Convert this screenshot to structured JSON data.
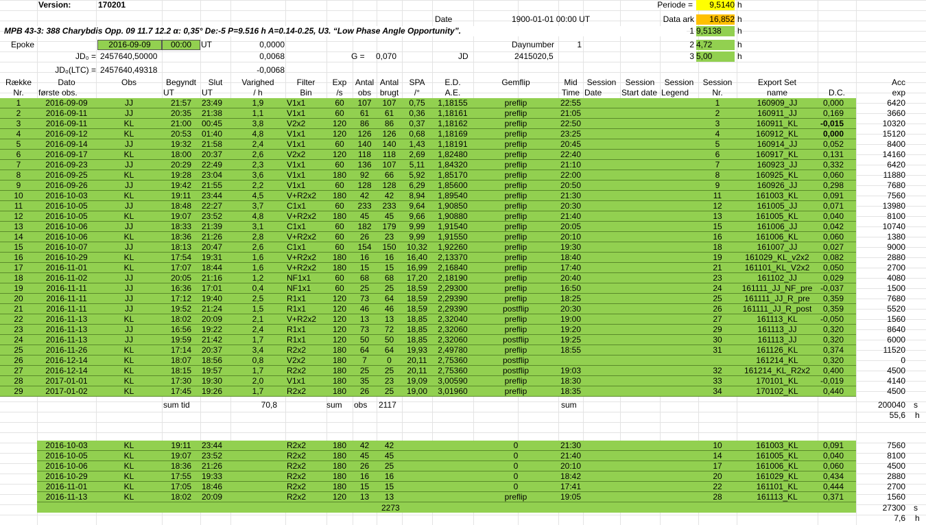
{
  "top": {
    "version_label": "Version:",
    "version_value": "170201",
    "periode_label": "Periode =",
    "periode_value": "9,5140",
    "periode_unit": "h",
    "date_label": "Date",
    "date_value": "1900-01-01  00:00  UT",
    "data_ark_label": "Data ark",
    "data_ark_value": "16,852",
    "data_ark_unit": "h",
    "title": "MPB 43-3: 388 Charybdis Opp. 09 11.7 12.2 α: 0,35° De:-5 P=9.516 h A=0.14-0.25, U3. “Low Phase Angle Opportunity”.",
    "p1_index": "1",
    "p1_value": "9,5138",
    "p1_unit": "h",
    "epoke_label": "Epoke",
    "epoke_date": "2016-09-09",
    "epoke_time": "00:00",
    "epoke_ut": "UT",
    "epoke_num": "0,0000",
    "daynumber_label": "Daynumber",
    "daynumber_value": "1",
    "p2_index": "2",
    "p2_value": "4,72",
    "p2_unit": "h",
    "jd0_label": "JD₀ =",
    "jd0_value": "2457640,50000",
    "jd0_num": "0,0068",
    "g_label": "G =",
    "g_value": "0,070",
    "jd_label": "JD",
    "jd_value": "2415020,5",
    "p3_index": "3",
    "p3_value": "5,00",
    "p3_unit": "h",
    "jd0ltc_label": "JD₀(LTC) =",
    "jd0ltc_value": "2457640,49318",
    "jd0ltc_num": "-0,0068",
    "colors": {
      "green": "#92d050",
      "yellow": "#ffff00",
      "orange": "#ffc000"
    }
  },
  "headers": {
    "row1": [
      "Række",
      "Dato",
      "Obs",
      "Begyndt",
      "Slut",
      "Varighed",
      "Filter",
      "Exp",
      "Antal",
      "Antal",
      "SPA",
      "E.D.",
      "Gemflip",
      "Mid",
      "Session",
      "Session",
      "Session",
      "Session",
      "Export Set",
      "",
      "Acc"
    ],
    "row2": [
      "Nr.",
      "første obs.",
      "",
      "UT",
      "UT",
      "/ h",
      "Bin",
      "/s",
      "obs",
      "brugt",
      "/°",
      "A.E.",
      "",
      "Time",
      "Date",
      "Start date",
      "Legend",
      "Nr.",
      "name",
      "D.C.",
      "exp"
    ]
  },
  "rows": [
    [
      "1",
      "2016-09-09",
      "JJ",
      "21:57",
      "23:49",
      "1,9",
      "V1x1",
      "60",
      "107",
      "107",
      "0,75",
      "1,18155",
      "preflip",
      "22:55",
      "1",
      "160909_JJ",
      "0,000",
      "6420"
    ],
    [
      "2",
      "2016-09-11",
      "JJ",
      "20:35",
      "21:38",
      "1,1",
      "V1x1",
      "60",
      "61",
      "61",
      "0,36",
      "1,18161",
      "preflip",
      "21:05",
      "2",
      "160911_JJ",
      "0,169",
      "3660"
    ],
    [
      "3",
      "2016-09-11",
      "KL",
      "21:00",
      "00:45",
      "3,8",
      "V2x2",
      "120",
      "86",
      "86",
      "0,37",
      "1,18162",
      "preflip",
      "22:50",
      "3",
      "160911_KL",
      "-0,015",
      "10320"
    ],
    [
      "4",
      "2016-09-12",
      "KL",
      "20:53",
      "01:40",
      "4,8",
      "V1x1",
      "120",
      "126",
      "126",
      "0,68",
      "1,18169",
      "preflip",
      "23:25",
      "4",
      "160912_KL",
      "0,000",
      "15120"
    ],
    [
      "5",
      "2016-09-14",
      "JJ",
      "19:32",
      "21:58",
      "2,4",
      "V1x1",
      "60",
      "140",
      "140",
      "1,43",
      "1,18191",
      "preflip",
      "20:45",
      "5",
      "160914_JJ",
      "0,052",
      "8400"
    ],
    [
      "6",
      "2016-09-17",
      "KL",
      "18:00",
      "20:37",
      "2,6",
      "V2x2",
      "120",
      "118",
      "118",
      "2,69",
      "1,82480",
      "preflip",
      "22:40",
      "6",
      "160917_KL",
      "0,131",
      "14160"
    ],
    [
      "7",
      "2016-09-23",
      "JJ",
      "20:29",
      "22:49",
      "2,3",
      "V1x1",
      "60",
      "136",
      "107",
      "5,11",
      "1,84320",
      "preflip",
      "21:10",
      "7",
      "160923_JJ",
      "0,332",
      "6420"
    ],
    [
      "8",
      "2016-09-25",
      "KL",
      "19:28",
      "23:04",
      "3,6",
      "V1x1",
      "180",
      "92",
      "66",
      "5,92",
      "1,85170",
      "preflip",
      "22:00",
      "8",
      "160925_KL",
      "0,060",
      "11880"
    ],
    [
      "9",
      "2016-09-26",
      "JJ",
      "19:42",
      "21:55",
      "2,2",
      "V1x1",
      "60",
      "128",
      "128",
      "6,29",
      "1,85600",
      "preflip",
      "20:50",
      "9",
      "160926_JJ",
      "0,298",
      "7680"
    ],
    [
      "10",
      "2016-10-03",
      "KL",
      "19:11",
      "23:44",
      "4,5",
      "V+R2x2",
      "180",
      "42",
      "42",
      "8,94",
      "1,89540",
      "preflip",
      "21:30",
      "11",
      "161003_KL",
      "0,091",
      "7560"
    ],
    [
      "11",
      "2016-10-05",
      "JJ",
      "18:48",
      "22:27",
      "3,7",
      "C1x1",
      "60",
      "233",
      "233",
      "9,64",
      "1,90850",
      "preflip",
      "20:30",
      "12",
      "161005_JJ",
      "0,071",
      "13980"
    ],
    [
      "12",
      "2016-10-05",
      "KL",
      "19:07",
      "23:52",
      "4,8",
      "V+R2x2",
      "180",
      "45",
      "45",
      "9,66",
      "1,90880",
      "preflip",
      "21:40",
      "13",
      "161005_KL",
      "0,040",
      "8100"
    ],
    [
      "13",
      "2016-10-06",
      "JJ",
      "18:33",
      "21:39",
      "3,1",
      "C1x1",
      "60",
      "182",
      "179",
      "9,99",
      "1,91540",
      "preflip",
      "20:05",
      "15",
      "161006_JJ",
      "0,042",
      "10740"
    ],
    [
      "14",
      "2016-10-06",
      "KL",
      "18:36",
      "21:26",
      "2,8",
      "V+R2x2",
      "60",
      "26",
      "23",
      "9,99",
      "1,91550",
      "preflip",
      "20:10",
      "16",
      "161006_KL",
      "0,060",
      "1380"
    ],
    [
      "15",
      "2016-10-07",
      "JJ",
      "18:13",
      "20:47",
      "2,6",
      "C1x1",
      "60",
      "154",
      "150",
      "10,32",
      "1,92260",
      "preflip",
      "19:30",
      "18",
      "161007_JJ",
      "0,027",
      "9000"
    ],
    [
      "16",
      "2016-10-29",
      "KL",
      "17:54",
      "19:31",
      "1,6",
      "V+R2x2",
      "180",
      "16",
      "16",
      "16,40",
      "2,13370",
      "preflip",
      "18:40",
      "19",
      "161029_KL_v2x2",
      "0,082",
      "2880"
    ],
    [
      "17",
      "2016-11-01",
      "KL",
      "17:07",
      "18:44",
      "1,6",
      "V+R2x2",
      "180",
      "15",
      "15",
      "16,99",
      "2,16840",
      "preflip",
      "17:40",
      "21",
      "161101_KL_V2x2",
      "0,050",
      "2700"
    ],
    [
      "18",
      "2016-11-02",
      "JJ",
      "20:05",
      "21:16",
      "1,2",
      "NF1x1",
      "60",
      "68",
      "68",
      "17,20",
      "2,18190",
      "preflip",
      "20:40",
      "23",
      "161102_JJ",
      "0,029",
      "4080"
    ],
    [
      "19",
      "2016-11-11",
      "JJ",
      "16:36",
      "17:01",
      "0,4",
      "NF1x1",
      "60",
      "25",
      "25",
      "18,59",
      "2,29300",
      "preflip",
      "16:50",
      "24",
      "161111_JJ_NF_pre",
      "-0,037",
      "1500"
    ],
    [
      "20",
      "2016-11-11",
      "JJ",
      "17:12",
      "19:40",
      "2,5",
      "R1x1",
      "120",
      "73",
      "64",
      "18,59",
      "2,29390",
      "preflip",
      "18:25",
      "25",
      "161111_JJ_R_pre",
      "0,359",
      "7680"
    ],
    [
      "21",
      "2016-11-11",
      "JJ",
      "19:52",
      "21:24",
      "1,5",
      "R1x1",
      "120",
      "46",
      "46",
      "18,59",
      "2,29390",
      "postflip",
      "20:30",
      "26",
      "161111_JJ_R_post",
      "0,359",
      "5520"
    ],
    [
      "22",
      "2016-11-13",
      "KL",
      "18:02",
      "20:09",
      "2,1",
      "V+R2x2",
      "120",
      "13",
      "13",
      "18,85",
      "2,32040",
      "preflip",
      "19:00",
      "27",
      "161113_KL",
      "-0,050",
      "1560"
    ],
    [
      "23",
      "2016-11-13",
      "JJ",
      "16:56",
      "19:22",
      "2,4",
      "R1x1",
      "120",
      "73",
      "72",
      "18,85",
      "2,32060",
      "preflip",
      "19:20",
      "29",
      "161113_JJ",
      "0,320",
      "8640"
    ],
    [
      "24",
      "2016-11-13",
      "JJ",
      "19:59",
      "21:42",
      "1,7",
      "R1x1",
      "120",
      "50",
      "50",
      "18,85",
      "2,32060",
      "postflip",
      "19:25",
      "30",
      "161113_JJ",
      "0,320",
      "6000"
    ],
    [
      "25",
      "2016-11-26",
      "KL",
      "17:14",
      "20:37",
      "3,4",
      "R2x2",
      "180",
      "64",
      "64",
      "19,93",
      "2,49780",
      "preflip",
      "18:55",
      "31",
      "161126_KL",
      "0,374",
      "11520"
    ],
    [
      "26",
      "2016-12-14",
      "KL",
      "18:07",
      "18:56",
      "0,8",
      "V2x2",
      "180",
      "7",
      "0",
      "20,11",
      "2,75360",
      "postflip",
      "",
      "",
      "161214_KL",
      "0,320",
      "0"
    ],
    [
      "27",
      "2016-12-14",
      "KL",
      "18:15",
      "19:57",
      "1,7",
      "R2x2",
      "180",
      "25",
      "25",
      "20,11",
      "2,75360",
      "postflip",
      "19:03",
      "32",
      "161214_KL_R2x2",
      "0,400",
      "4500"
    ],
    [
      "28",
      "2017-01-01",
      "KL",
      "17:30",
      "19:30",
      "2,0",
      "V1x1",
      "180",
      "35",
      "23",
      "19,09",
      "3,00590",
      "preflip",
      "18:30",
      "33",
      "170101_KL",
      "-0,019",
      "4140"
    ],
    [
      "29",
      "2017-01-02",
      "KL",
      "17:45",
      "19:26",
      "1,7",
      "R2x2",
      "180",
      "26",
      "25",
      "19,00",
      "3,01960",
      "preflip",
      "18:35",
      "34",
      "170102_KL",
      "0,440",
      "4500"
    ]
  ],
  "sum1": {
    "sum_tid": "sum tid",
    "varighed": "70,8",
    "sum": "sum",
    "obs": "obs",
    "brugt": "2117",
    "mid_sum": "sum",
    "acc": "200040",
    "acc_unit": "s",
    "hours": "55,6",
    "hours_unit": "h"
  },
  "rows2": [
    [
      "2016-10-03",
      "KL",
      "19:11",
      "23:44",
      "R2x2",
      "180",
      "42",
      "42",
      "0",
      "21:30",
      "10",
      "161003_KL",
      "0,091",
      "7560"
    ],
    [
      "2016-10-05",
      "KL",
      "19:07",
      "23:52",
      "R2x2",
      "180",
      "45",
      "45",
      "0",
      "21:40",
      "14",
      "161005_KL",
      "0,040",
      "8100"
    ],
    [
      "2016-10-06",
      "KL",
      "18:36",
      "21:26",
      "R2x2",
      "180",
      "26",
      "25",
      "0",
      "20:10",
      "17",
      "161006_KL",
      "0,060",
      "4500"
    ],
    [
      "2016-10-29",
      "KL",
      "17:55",
      "19:33",
      "R2x2",
      "180",
      "16",
      "16",
      "0",
      "18:42",
      "20",
      "161029_KL",
      "0,434",
      "2880"
    ],
    [
      "2016-11-01",
      "KL",
      "17:05",
      "18:46",
      "R2x2",
      "180",
      "15",
      "15",
      "0",
      "17:41",
      "22",
      "161101_KL",
      "0,444",
      "2700"
    ],
    [
      "2016-11-13",
      "KL",
      "18:02",
      "20:09",
      "R2x2",
      "120",
      "13",
      "13",
      "preflip",
      "19:05",
      "28",
      "161113_KL",
      "0,371",
      "1560"
    ]
  ],
  "sum2": {
    "brugt": "2273",
    "acc": "27300",
    "acc_unit": "s",
    "hours": "7,6",
    "hours_unit": "h"
  }
}
